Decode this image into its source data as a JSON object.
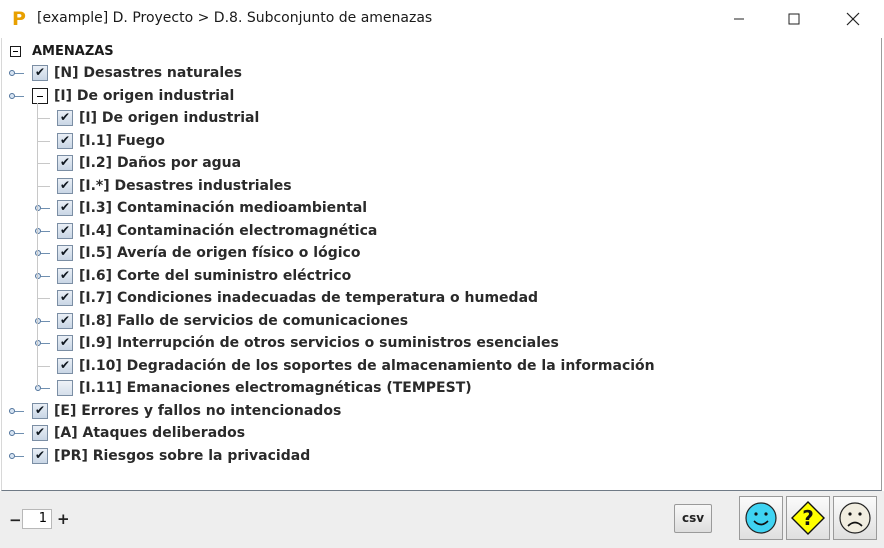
{
  "window": {
    "title": "[example] D. Proyecto > D.8. Subconjunto de amenazas",
    "minimize_icon": "minimize-icon",
    "maximize_icon": "maximize-icon",
    "close_icon": "close-icon"
  },
  "tree": {
    "root_label": "AMENAZAS",
    "items": [
      {
        "label": "[N] Desastres naturales",
        "checked": true,
        "level": 1
      },
      {
        "label": "[I] De origen industrial",
        "expanded": true,
        "level": 1
      },
      {
        "label": "[I] De origen industrial",
        "checked": true,
        "level": 2
      },
      {
        "label": "[I.1] Fuego",
        "checked": true,
        "level": 2
      },
      {
        "label": "[I.2] Daños por agua",
        "checked": true,
        "level": 2
      },
      {
        "label": "[I.*] Desastres industriales",
        "checked": true,
        "level": 2
      },
      {
        "label": "[I.3] Contaminación medioambiental",
        "checked": true,
        "level": 2
      },
      {
        "label": "[I.4] Contaminación electromagnética",
        "checked": true,
        "level": 2
      },
      {
        "label": "[I.5] Avería de origen físico o lógico",
        "checked": true,
        "level": 2
      },
      {
        "label": "[I.6] Corte del suministro eléctrico",
        "checked": true,
        "level": 2
      },
      {
        "label": "[I.7] Condiciones inadecuadas de temperatura o humedad",
        "checked": true,
        "level": 2
      },
      {
        "label": "[I.8] Fallo de servicios de comunicaciones",
        "checked": true,
        "level": 2
      },
      {
        "label": "[I.9] Interrupción de otros servicios o suministros esenciales",
        "checked": true,
        "level": 2
      },
      {
        "label": "[I.10] Degradación de los soportes de almacenamiento de la información",
        "checked": true,
        "level": 2
      },
      {
        "label": "[I.11] Emanaciones electromagnéticas (TEMPEST)",
        "checked": false,
        "level": 2
      },
      {
        "label": "[E] Errores y fallos no intencionados",
        "checked": true,
        "level": 1
      },
      {
        "label": "[A] Ataques deliberados",
        "checked": true,
        "level": 1
      },
      {
        "label": "[PR] Riesgos sobre la privacidad",
        "checked": true,
        "level": 1
      }
    ]
  },
  "bottom": {
    "zoom_minus": "−",
    "zoom_value": "1",
    "zoom_plus": "+",
    "csv_label": "csv",
    "buttons": [
      "smiley-happy-icon",
      "question-warning-icon",
      "smiley-sad-icon"
    ]
  },
  "colors": {
    "happy_face": "#3fd3f2",
    "warning_face": "#ffff00",
    "sad_face": "#f1ede0"
  }
}
